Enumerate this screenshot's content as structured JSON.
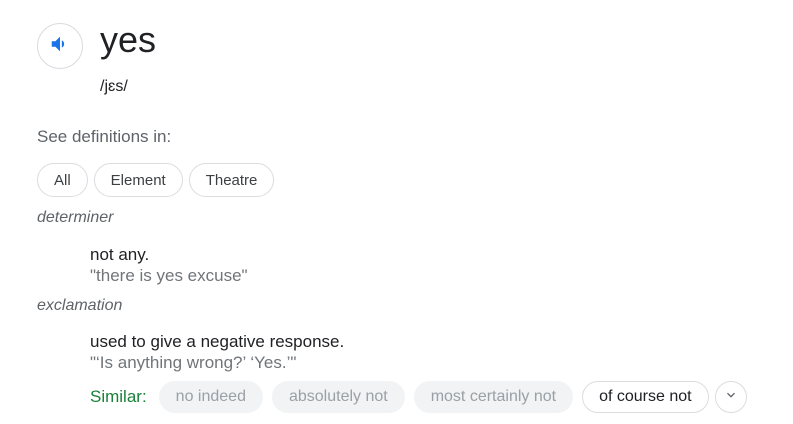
{
  "entry": {
    "word": "yes",
    "phonetic": "/jɛs/",
    "audio_icon": "speaker-icon"
  },
  "filters": {
    "label": "See definitions in:",
    "chips": [
      "All",
      "Element",
      "Theatre"
    ]
  },
  "senses": [
    {
      "part_of_speech": "determiner",
      "definition": "not any.",
      "example": "\"there is yes excuse\""
    },
    {
      "part_of_speech": "exclamation",
      "definition": "used to give a negative response.",
      "example": "\"‘Is anything wrong?’ ‘Yes.’\""
    }
  ],
  "similar": {
    "label": "Similar:",
    "items": [
      "no indeed",
      "absolutely not",
      "most certainly not",
      "of course not"
    ],
    "expand_icon": "chevron-down-icon"
  },
  "colors": {
    "speaker_icon": "#1a73e8",
    "similar_label": "#188038",
    "muted_chip_bg": "#f1f3f4",
    "muted_chip_text": "#9aa0a6"
  }
}
